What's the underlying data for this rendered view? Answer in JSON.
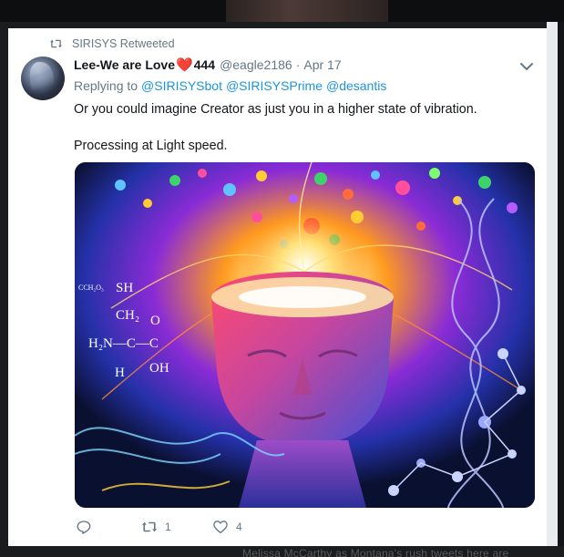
{
  "retweet_context": {
    "icon": "retweet-icon",
    "text": "SIRISYS Retweeted"
  },
  "tweet": {
    "display_name": "Lee-We are Love",
    "name_emoji": "❤️",
    "name_suffix": "444",
    "handle": "@eagle2186",
    "separator": "·",
    "date": "Apr 17",
    "replying_label": "Replying to",
    "replying_to": [
      "@SIRISYSbot",
      "@SIRISYSPrime",
      "@desantis"
    ],
    "text_paragraphs": [
      "Or you could imagine Creator as just you in a higher state of vibration.",
      "Processing at Light speed."
    ],
    "media": {
      "description_icon": "spiritual-head-illustration",
      "formula_labels": [
        "SH",
        "CH₂",
        "O",
        "H₂N—C—C",
        "H",
        "OH",
        "CCH₂O₃"
      ]
    }
  },
  "actions": {
    "reply": {
      "icon": "reply-icon",
      "count": ""
    },
    "retweet": {
      "icon": "retweet-icon",
      "count": "1"
    },
    "like": {
      "icon": "heart-icon",
      "count": "4"
    }
  },
  "background": {
    "bottom_text": "Melissa McCarthy as Montana's rush tweets here are"
  },
  "colors": {
    "link": "#1b95e0",
    "secondary_text": "#657786",
    "primary_text": "#14171a",
    "heart": "#e0245e"
  }
}
